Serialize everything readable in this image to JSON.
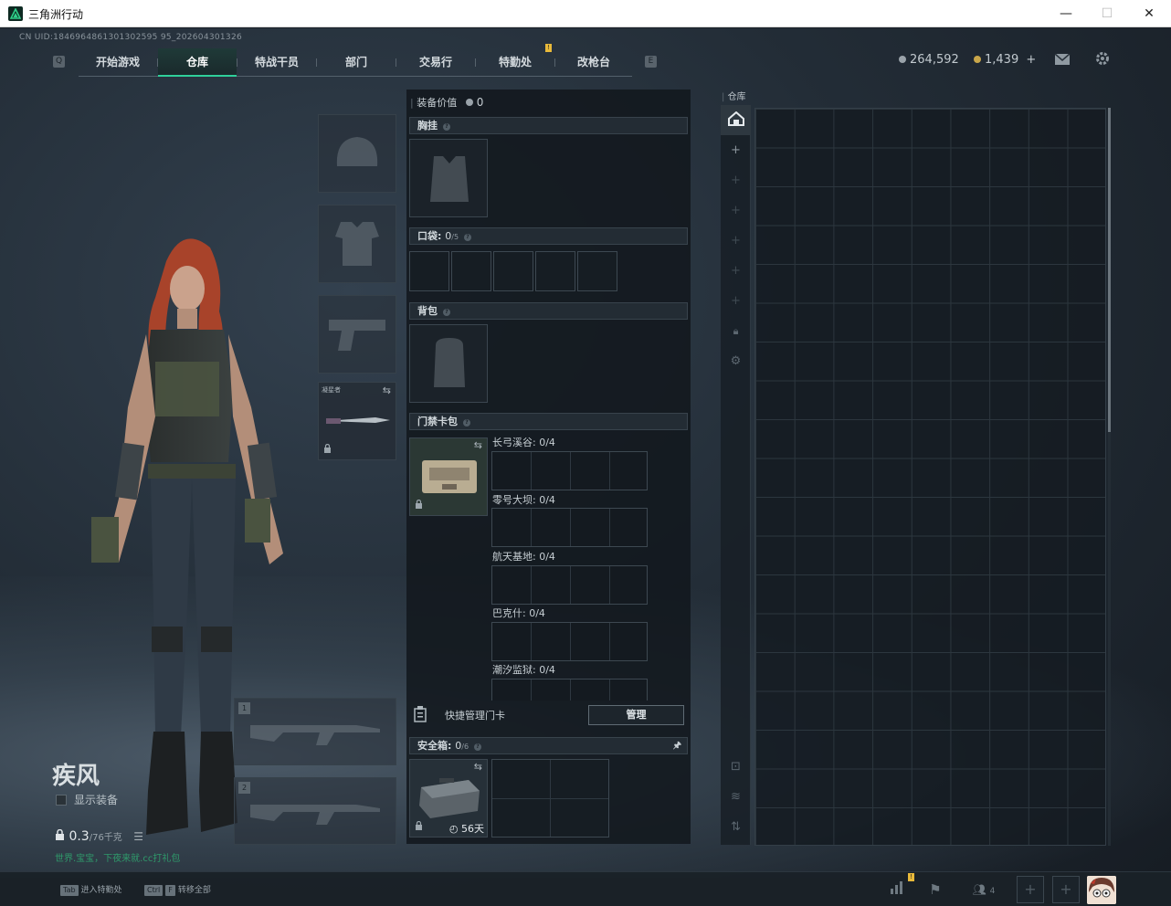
{
  "window": {
    "title": "三角洲行动",
    "minimize": "—",
    "maximize": "☐",
    "close": "✕"
  },
  "uid": "CN UID:1846964861301302595 95_202604301326",
  "nav": {
    "left_key": "Q",
    "right_key": "E",
    "tabs": [
      "开始游戏",
      "仓库",
      "特战干员",
      "部门",
      "交易行",
      "特勤处",
      "改枪台"
    ],
    "active": "仓库",
    "notification": "!"
  },
  "currency": {
    "silver": "264,592",
    "gold": "1,439",
    "gold_add": "+"
  },
  "icons": {
    "mail": "mail-icon",
    "settings": "gear-icon"
  },
  "operator": {
    "name": "疾风",
    "show_equipment": "显示装备",
    "weight": "0.3",
    "weight_max": "/76千克",
    "promo": "世界.宝宝，下夜来就.cc打礼包"
  },
  "slots": {
    "melee_label": "凝星者",
    "weapon1": "1",
    "weapon2": "2"
  },
  "equipment": {
    "value_label": "装备价值",
    "value": "0",
    "chest_rig": "胸挂",
    "pocket": "口袋:",
    "pocket_count": "0",
    "pocket_max": "/5",
    "backpack": "背包",
    "keycard_bag": "门禁卡包",
    "keycards": [
      {
        "label": "长弓溪谷: 0/4"
      },
      {
        "label": "零号大坝: 0/4"
      },
      {
        "label": "航天基地: 0/4"
      },
      {
        "label": "巴克什: 0/4"
      },
      {
        "label": "潮汐监狱: 0/4"
      }
    ],
    "quick_manage": "快捷管理门卡",
    "manage_btn": "管理",
    "safe_box": "安全箱:",
    "safe_count": "0",
    "safe_max": "/6",
    "safe_days": "56天"
  },
  "warehouse": {
    "title": "仓库"
  },
  "bottom": {
    "hint1_key": "Tab",
    "hint1": "进入特勤处",
    "hint2_key1": "Ctrl",
    "hint2_key2": "F",
    "hint2": "转移全部",
    "friends": "4",
    "notification": "!"
  }
}
